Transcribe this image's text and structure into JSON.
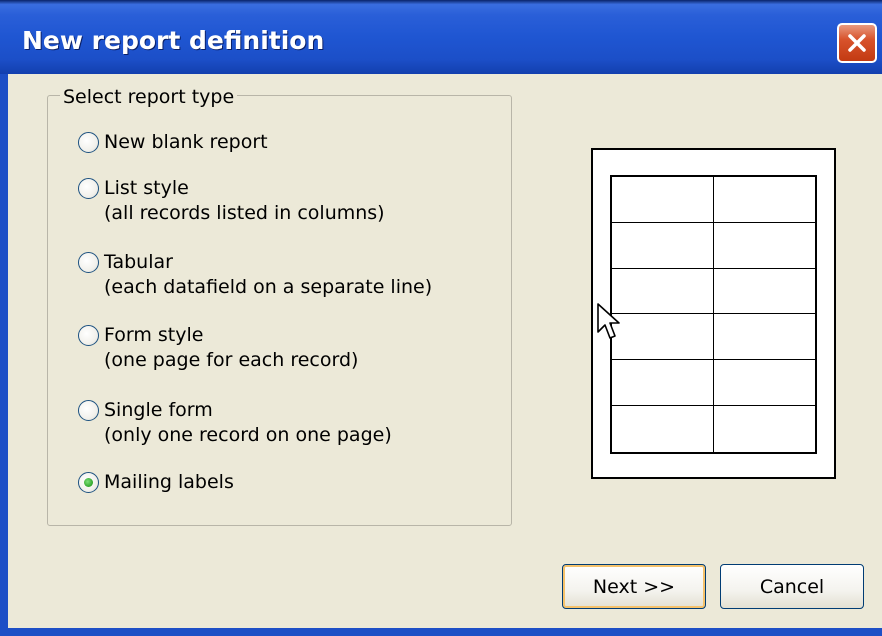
{
  "window": {
    "title": "New report definition"
  },
  "group": {
    "legend": "Select report type"
  },
  "options": [
    {
      "label": "New blank report",
      "sub": "",
      "checked": false
    },
    {
      "label": "List style",
      "sub": "(all records listed in columns)",
      "checked": false
    },
    {
      "label": "Tabular",
      "sub": "(each datafield on a separate line)",
      "checked": false
    },
    {
      "label": "Form style",
      "sub": "(one page for each record)",
      "checked": false
    },
    {
      "label": "Single form",
      "sub": "(only one record on one page)",
      "checked": false
    },
    {
      "label": "Mailing labels",
      "sub": "",
      "checked": true
    }
  ],
  "buttons": {
    "next": "Next >>",
    "cancel": "Cancel"
  },
  "icons": {
    "close": "close-icon",
    "cursor": "mouse-cursor-icon"
  },
  "colors": {
    "titlebar": "#1f56d2",
    "close_button": "#d8532c",
    "selected_radio": "#2fa52a"
  }
}
